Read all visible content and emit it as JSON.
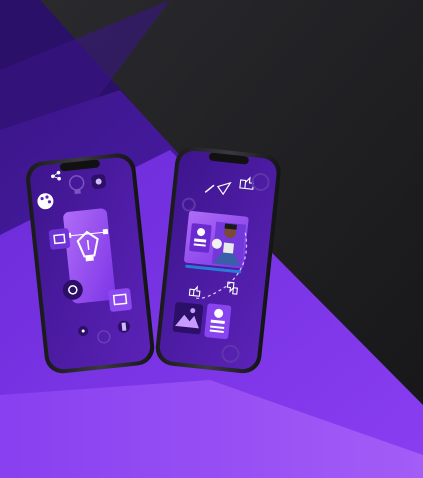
{
  "scene": {
    "background": {
      "dark": "#1d1d20",
      "dark_light": "#2a2a2e",
      "purple_deep": "#4b1c9b",
      "purple_mid": "#6a2bd0",
      "purple_bright": "#8a3df0",
      "purple_light": "#a45cf5"
    },
    "phones": [
      {
        "name": "design-tools-phone",
        "screen_color": "#45189a",
        "icons": [
          "palette-icon",
          "lightbulb-icon",
          "bug-icon",
          "pen-tool-icon",
          "archive-icon",
          "gear-icon",
          "share-icon",
          "usb-icon"
        ]
      },
      {
        "name": "social-media-phone",
        "screen_color": "#45189a",
        "icons": [
          "send-icon",
          "pen-icon",
          "thumbs-up-icon",
          "megaphone-icon",
          "profile-card-icon",
          "landscape-photo-icon",
          "user-card-icon",
          "gear-icon"
        ]
      }
    ]
  }
}
